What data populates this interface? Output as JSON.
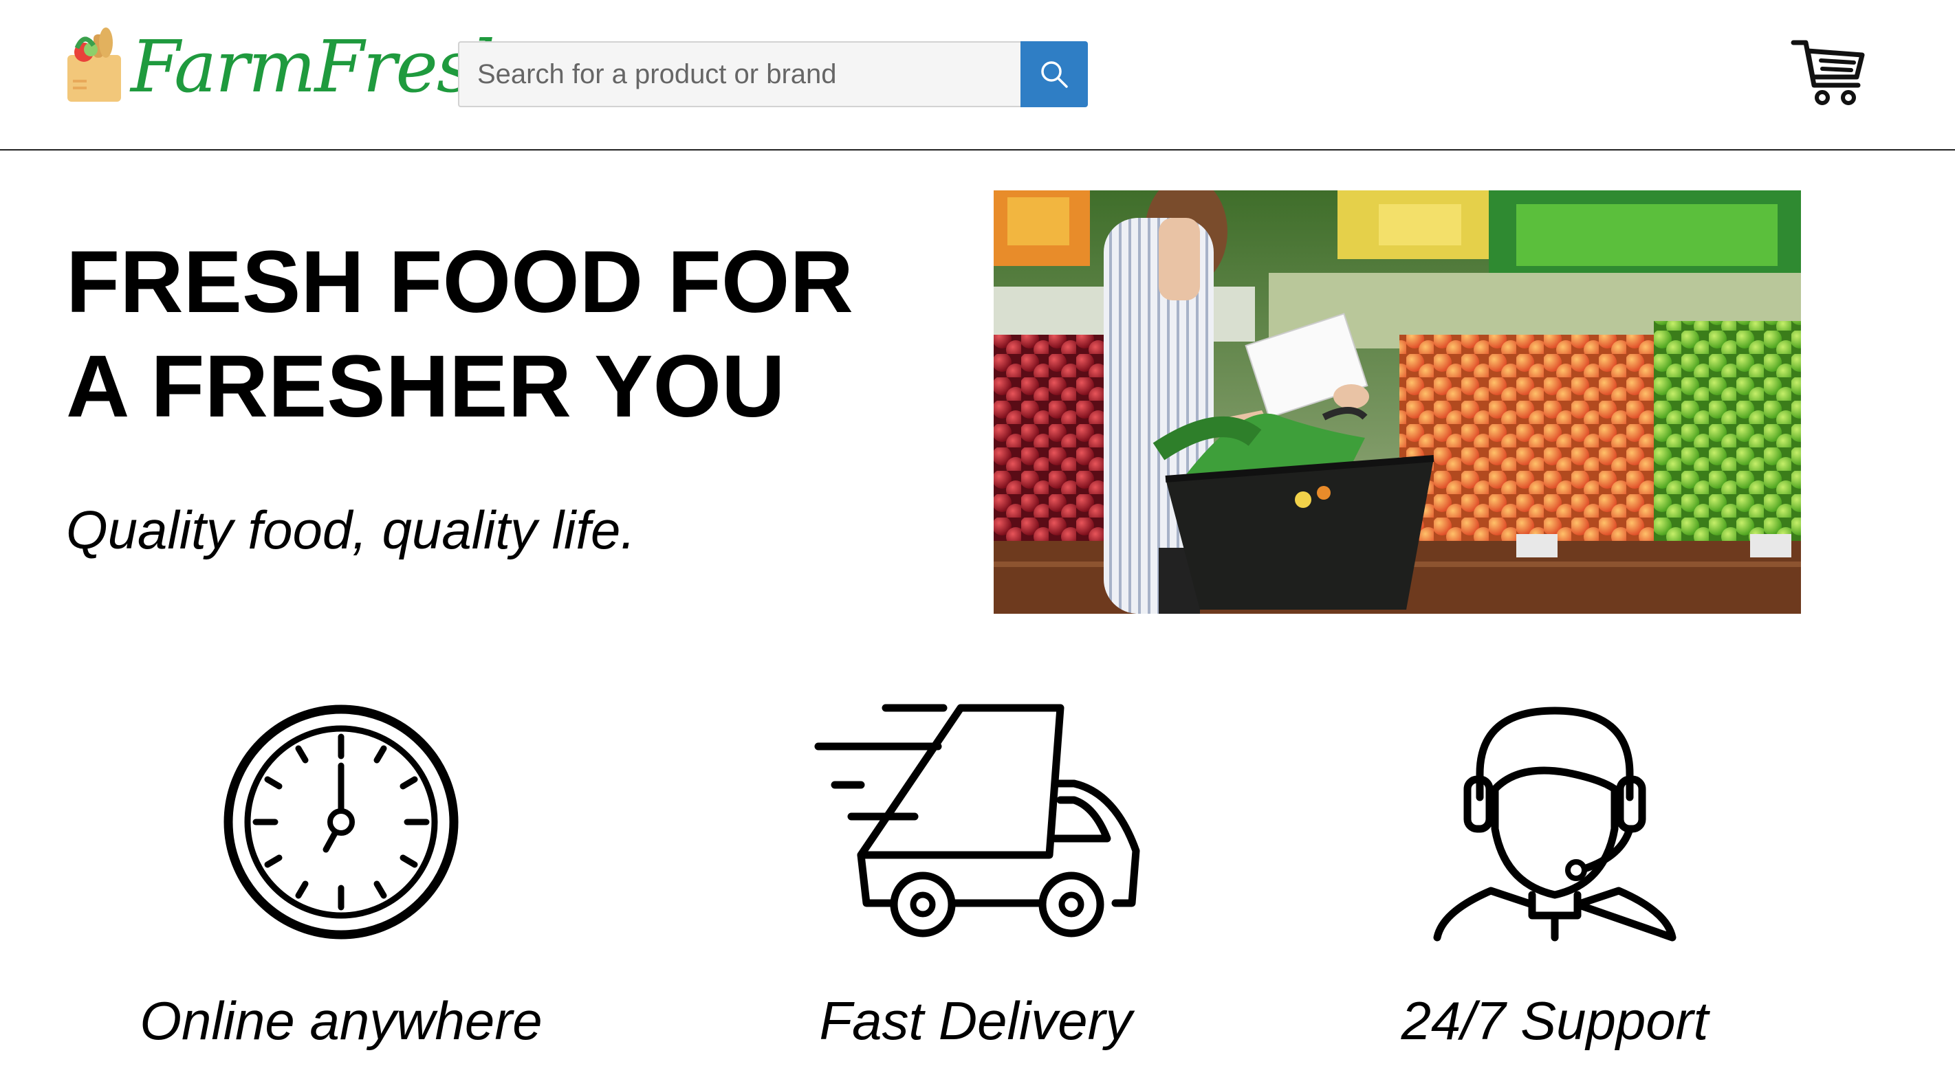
{
  "brand": {
    "name": "FarmFresh"
  },
  "search": {
    "placeholder": "Search for a product or brand",
    "button_icon": "search-icon"
  },
  "header": {
    "cart_icon": "cart-icon"
  },
  "hero": {
    "title": "FRESH FOOD FOR\nA FRESHER YOU",
    "subtitle": "Quality food, quality life."
  },
  "features": [
    {
      "icon": "clock-icon",
      "label": "Online anywhere"
    },
    {
      "icon": "delivery-truck-icon",
      "label": "Fast Delivery"
    },
    {
      "icon": "support-agent-icon",
      "label": "24/7 Support"
    }
  ],
  "colors": {
    "brand_green": "#1f9a3e",
    "search_button": "#2f7ec5"
  }
}
